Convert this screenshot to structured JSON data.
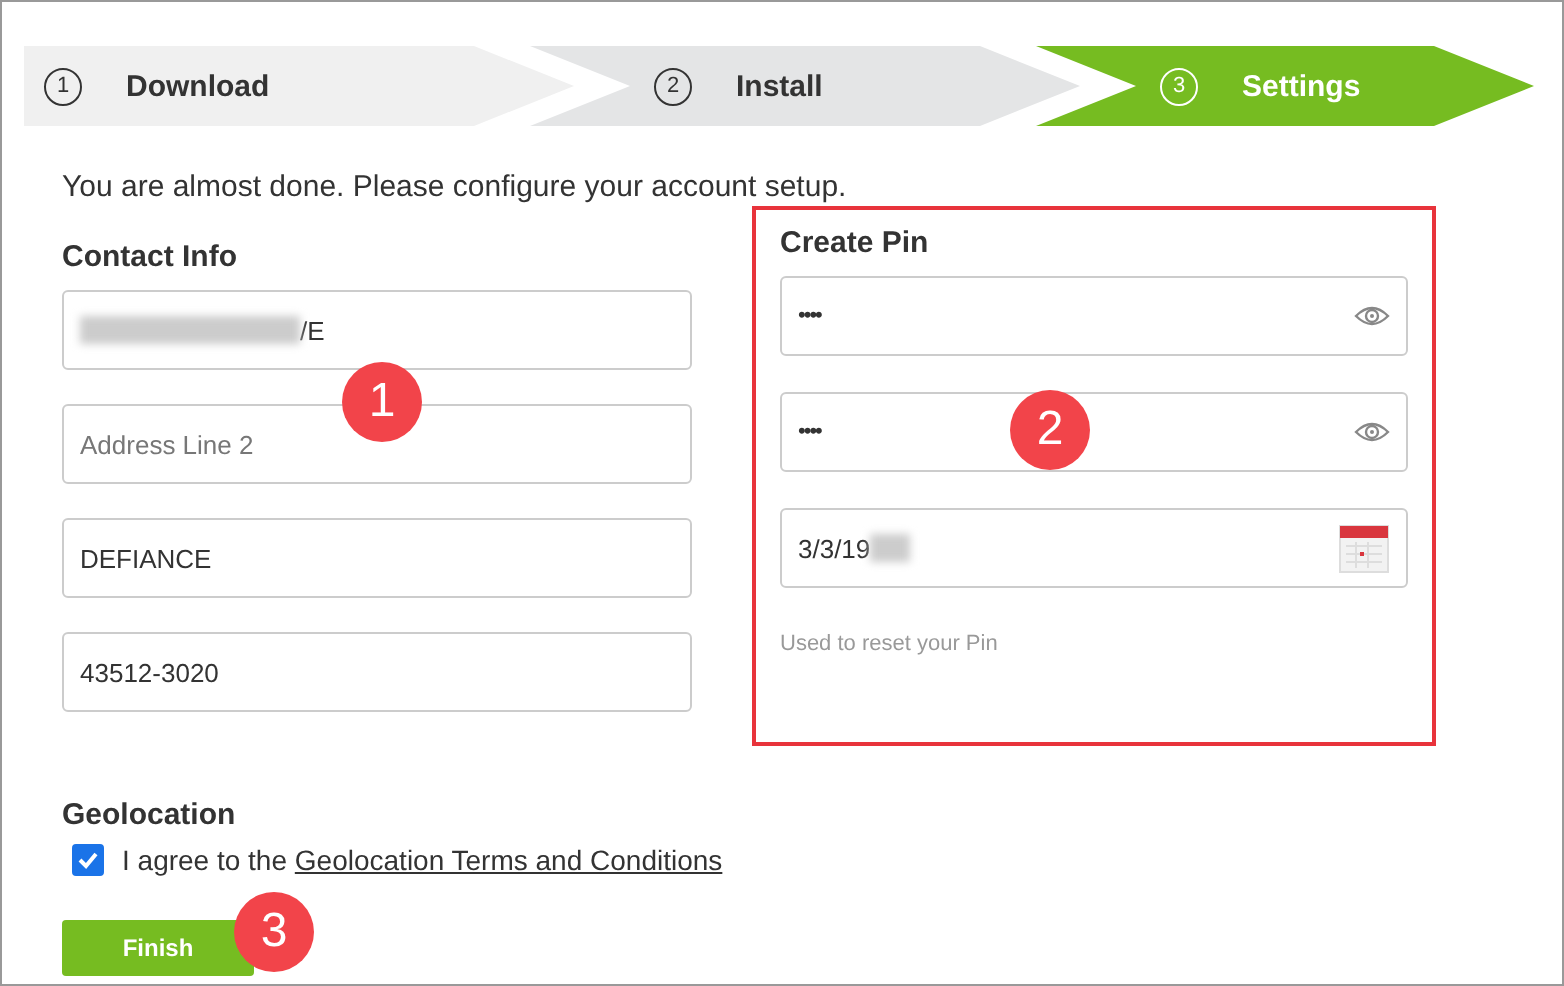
{
  "steps": [
    {
      "number": "1",
      "label": "Download",
      "selected": false
    },
    {
      "number": "2",
      "label": "Install",
      "selected": false
    },
    {
      "number": "3",
      "label": "Settings",
      "selected": true
    }
  ],
  "intro": "You are almost done. Please configure your account setup.",
  "contact": {
    "title": "Contact Info",
    "fields": [
      {
        "value": "/E",
        "redacted": true
      },
      {
        "placeholder": "Address Line 2"
      },
      {
        "value": "DEFIANCE"
      },
      {
        "value": "43512-3020"
      }
    ]
  },
  "pin": {
    "title": "Create Pin",
    "highlighted": true,
    "fields": [
      {
        "kind": "password",
        "value": "••••"
      },
      {
        "kind": "password",
        "value": "••••"
      },
      {
        "kind": "date",
        "value": "3/3/19",
        "redacted": true
      }
    ],
    "hint": "Used to reset your Pin"
  },
  "geolocation": {
    "title": "Geolocation",
    "checked": true,
    "text": "I agree to the ",
    "link": "Geolocation Terms and Conditions"
  },
  "finish": "Finish",
  "annotations": [
    "1",
    "2",
    "3"
  ]
}
